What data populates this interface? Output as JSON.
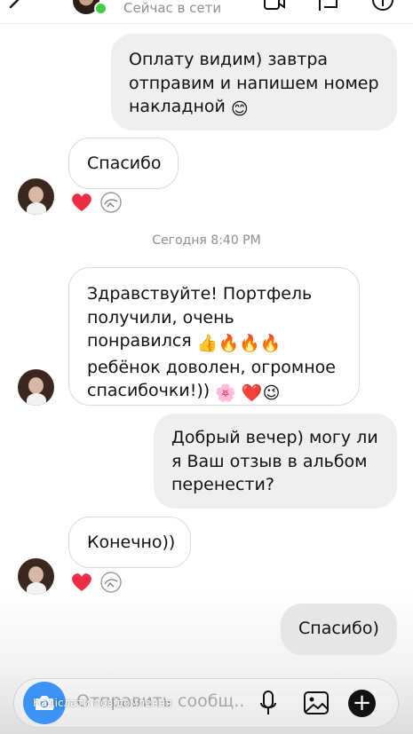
{
  "header": {
    "status": "Сейчас в сети",
    "online_color": "#3fcf4a"
  },
  "messages": [
    {
      "side": "out",
      "text": "Оплату видим) завтра отправим и напишем номер накладной",
      "emoji": "😊"
    },
    {
      "side": "in",
      "text": "Спасибо",
      "reactions": [
        "heart-icon",
        "sticker-icon"
      ]
    },
    {
      "side": "in",
      "text": "Здравствуйте! Портфель получили, очень понравился",
      "emoji_line": "👍🔥🔥🔥",
      "text2": "ребёнок доволен, огромное спасибочки!))",
      "emoji2": "🌸",
      "emoji3": "❤️😉"
    },
    {
      "side": "out",
      "text": "Добрый вечер) могу ли я Ваш отзыв в альбом перенести?"
    },
    {
      "side": "in",
      "text": "Конечно))",
      "reactions": [
        "heart-icon",
        "sticker-icon"
      ]
    },
    {
      "side": "out",
      "text": "Спасибо)"
    }
  ],
  "timestamp": "Сегодня 8:40 PM",
  "composer": {
    "placeholder": "Отправить сообщ...",
    "overlay_caption": "Надіслати повідомлення"
  },
  "colors": {
    "accent": "#3b93f5",
    "outgoing_bubble": "#efefef",
    "heart": "#ed2e44"
  }
}
